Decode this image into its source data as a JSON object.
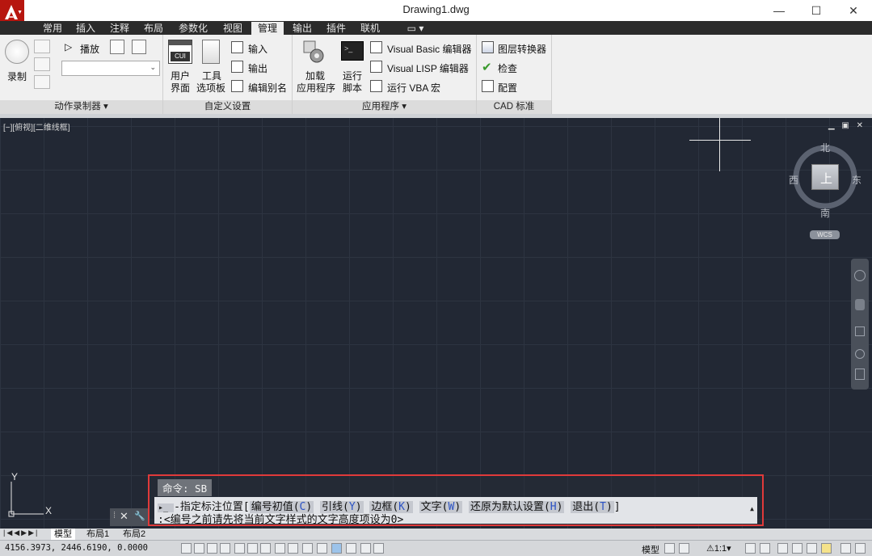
{
  "window": {
    "title": "Drawing1.dwg",
    "minimize": "—",
    "maximize": "☐",
    "close": "✕"
  },
  "ribbon_tabs": [
    "常用",
    "插入",
    "注释",
    "布局",
    "参数化",
    "视图",
    "管理",
    "输出",
    "插件",
    "联机"
  ],
  "active_tab": "管理",
  "ribbon": {
    "record": "录制",
    "play": "播放",
    "action_recorder_group": "动作录制器 ▾",
    "user_interface": [
      "用户",
      "界面"
    ],
    "tool_palettes": [
      "工具",
      "选项板"
    ],
    "import": "输入",
    "export": "输出",
    "edit_aliases": "编辑别名",
    "customization_group": "自定义设置",
    "load_app": [
      "加载",
      "应用程序"
    ],
    "run_script": [
      "运行",
      "脚本"
    ],
    "vb_editor": "Visual Basic 编辑器",
    "lisp_editor": "Visual LISP 编辑器",
    "run_vba": "运行 VBA 宏",
    "applications_group": "应用程序 ▾",
    "layer_translator": "图层转换器",
    "check": "检查",
    "configure": "配置",
    "cad_standards_group": "CAD 标准",
    "cui_icon_text": "CUI"
  },
  "viewport": {
    "label": "[−][俯视][二维线框]",
    "controls": "▁ ▣ ✕"
  },
  "viewcube": {
    "north": "北",
    "south": "南",
    "east": "东",
    "west": "西",
    "top": "上",
    "wcs": "WCS"
  },
  "ucs": {
    "x": "X",
    "y": "Y"
  },
  "command": {
    "history": "命令: SB",
    "prompt_prefix": "▸_ ",
    "prompt": "-指定标注位置[",
    "options": [
      {
        "label": "编号初值(",
        "key": "C",
        "end": ")"
      },
      {
        "label": "引线(",
        "key": "Y",
        "end": ")"
      },
      {
        "label": "边框(",
        "key": "K",
        "end": ")"
      },
      {
        "label": "文字(",
        "key": "W",
        "end": ")"
      },
      {
        "label": "还原为默认设置(",
        "key": "H",
        "end": ")"
      },
      {
        "label": "退出(",
        "key": "T",
        "end": ")"
      }
    ],
    "prompt_close": "]",
    "hint": ":<编号之前请先将当前文字样式的文字高度项设为0>",
    "grip_close": "✕",
    "grip_settings": "🔧"
  },
  "layout_tabs": [
    "模型",
    "布局1",
    "布局2"
  ],
  "status": {
    "coords": "4156.3973, 2446.6190, 0.0000",
    "model": "模型",
    "scale": "1:1"
  },
  "colors": {
    "canvas": "#222834",
    "accent_red": "#e03a3a",
    "logo_red": "#b7160f"
  }
}
